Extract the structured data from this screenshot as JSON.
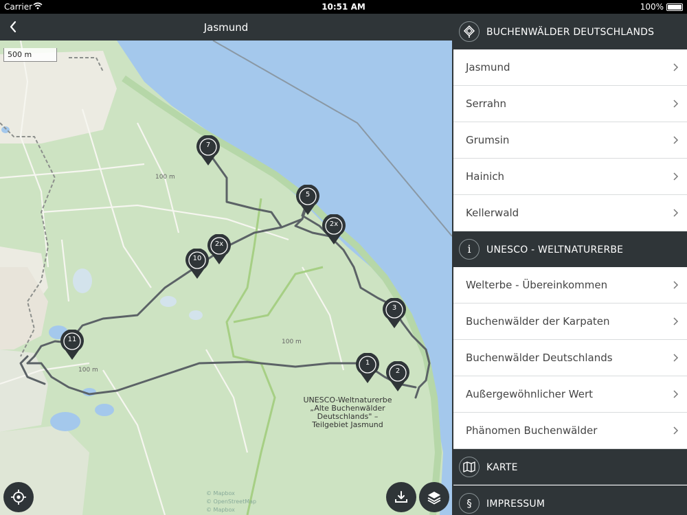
{
  "status_bar": {
    "carrier": "Carrier",
    "time": "10:51 AM",
    "battery": "100%"
  },
  "map": {
    "title": "Jasmund",
    "scale": "500 m",
    "contour_labels": [
      "100 m",
      "100 m",
      "100 m"
    ],
    "area_label": "UNESCO-Weltnaturerbe „Alte Buchenwälder Deutschlands\" – Teilgebiet Jasmund",
    "attribution": [
      "© Mapbox",
      "© OpenStreetMap",
      "© Mapbox"
    ],
    "markers": [
      "7",
      "5",
      "2x",
      "2x",
      "10",
      "3",
      "11",
      "1",
      "2"
    ]
  },
  "panel": {
    "section1": {
      "title": "BUCHENWÄLDER DEUTSCHLANDS",
      "icon": "beech-leaf-icon"
    },
    "section1_items": [
      "Jasmund",
      "Serrahn",
      "Grumsin",
      "Hainich",
      "Kellerwald"
    ],
    "section2": {
      "title": "UNESCO - WELTNATURERBE",
      "icon": "info-icon",
      "icon_glyph": "i"
    },
    "section2_items": [
      "Welterbe - Übereinkommen",
      "Buchenwälder der Karpaten",
      "Buchenwälder Deutschlands",
      "Außergewöhnlicher Wert",
      "Phänomen Buchenwälder"
    ],
    "section3": {
      "title": "KARTE",
      "icon": "map-icon"
    },
    "section4": {
      "title": "IMPRESSUM",
      "icon": "paragraph-icon",
      "icon_glyph": "§"
    }
  },
  "colors": {
    "dark": "#2f3538",
    "water": "#a4c8ec",
    "land": "#cde3c2",
    "trail": "#5b6266"
  }
}
